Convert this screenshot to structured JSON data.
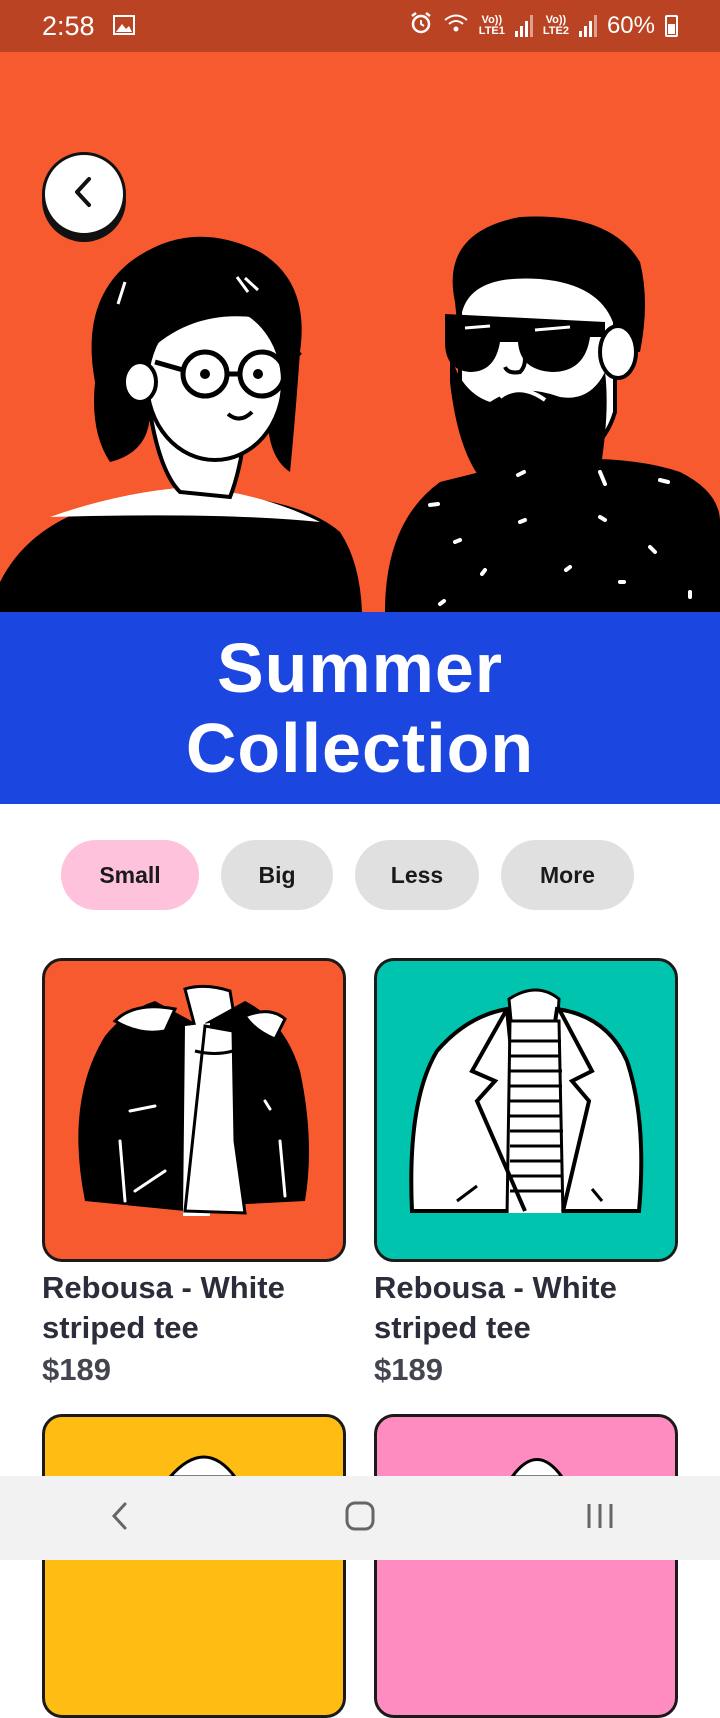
{
  "status_bar": {
    "time": "2:58",
    "lte1_top": "Vo))",
    "lte1_bottom": "LTE1",
    "lte2_top": "Vo))",
    "lte2_bottom": "LTE2",
    "battery": "60%",
    "icons": [
      "image-icon",
      "alarm-icon",
      "wifi-icon",
      "signal-icon",
      "battery-icon"
    ]
  },
  "hero": {
    "title": "Summer Collection",
    "back_icon": "chevron-left-icon",
    "colors": {
      "background": "#f85a30",
      "banner": "#1c46e0"
    }
  },
  "filters": [
    {
      "label": "Small",
      "active": true
    },
    {
      "label": "Big",
      "active": false
    },
    {
      "label": "Less",
      "active": false
    },
    {
      "label": "More",
      "active": false
    }
  ],
  "products": [
    {
      "title": "Rebousa - White striped tee",
      "price": "$189",
      "bg": "#f85a30"
    },
    {
      "title": "Rebousa - White striped tee",
      "price": "$189",
      "bg": "#00c4ad"
    },
    {
      "title": "",
      "price": "",
      "bg": "#ffbc12"
    },
    {
      "title": "",
      "price": "",
      "bg": "#ff8cc0"
    }
  ],
  "nav": {
    "icons": [
      "back-nav-icon",
      "home-nav-icon",
      "recents-nav-icon"
    ]
  }
}
